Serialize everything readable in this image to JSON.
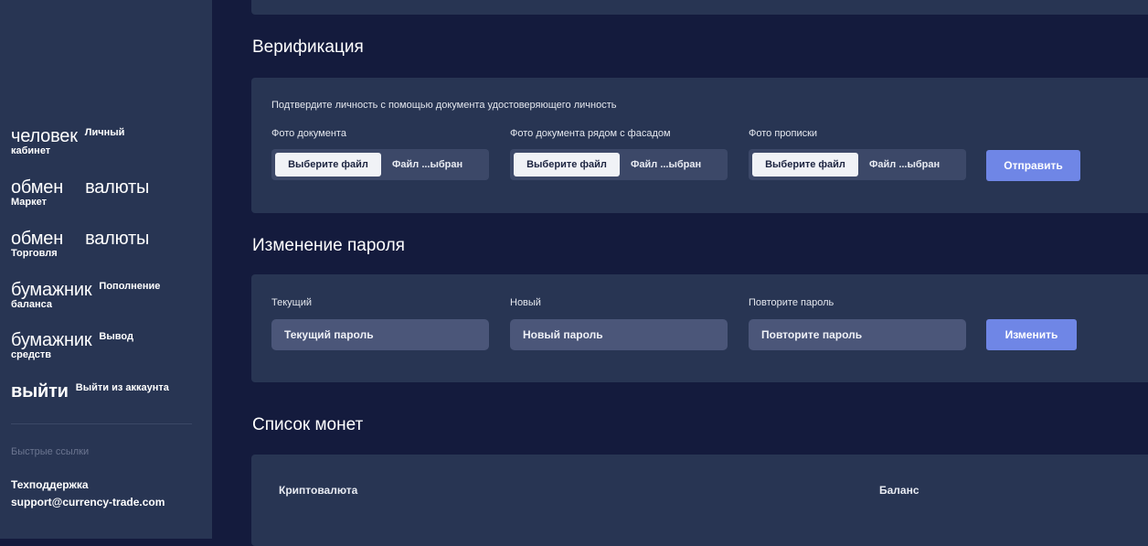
{
  "sidebar": {
    "items": [
      {
        "big": "человек",
        "small": "Личный",
        "sub": "кабинет"
      },
      {
        "big": "обмен",
        "big2": "валюты",
        "sub": "Маркет"
      },
      {
        "big": "обмен",
        "big2": "валюты",
        "sub": "Торговля"
      },
      {
        "big": "бумажник",
        "small": "Пополнение",
        "sub": "баланса"
      },
      {
        "big": "бумажник",
        "small": "Вывод",
        "sub": "средств"
      },
      {
        "big": "выйти",
        "small": "Выйти из аккаунта"
      }
    ],
    "quick_links_title": "Быстрые ссылки",
    "support_label": "Техподдержка",
    "support_email": "support@currency-trade.com"
  },
  "verification": {
    "title": "Верификация",
    "description": "Подтвердите личность с помощью документа удостоверяющего личность",
    "fields": [
      {
        "label": "Фото документа",
        "button": "Выберите файл",
        "status": "Файл ...ыбран"
      },
      {
        "label": "Фото документа рядом с фасадом",
        "button": "Выберите файл",
        "status": "Файл ...ыбран"
      },
      {
        "label": "Фото прописки",
        "button": "Выберите файл",
        "status": "Файл ...ыбран"
      }
    ],
    "submit": "Отправить"
  },
  "password": {
    "title": "Изменение пароля",
    "fields": [
      {
        "label": "Текущий",
        "placeholder": "Текущий пароль"
      },
      {
        "label": "Новый",
        "placeholder": "Новый пароль"
      },
      {
        "label": "Повторите пароль",
        "placeholder": "Повторите пароль"
      }
    ],
    "submit": "Изменить"
  },
  "coins": {
    "title": "Список монет",
    "columns": [
      "Криптовалюта",
      "Баланс"
    ]
  }
}
